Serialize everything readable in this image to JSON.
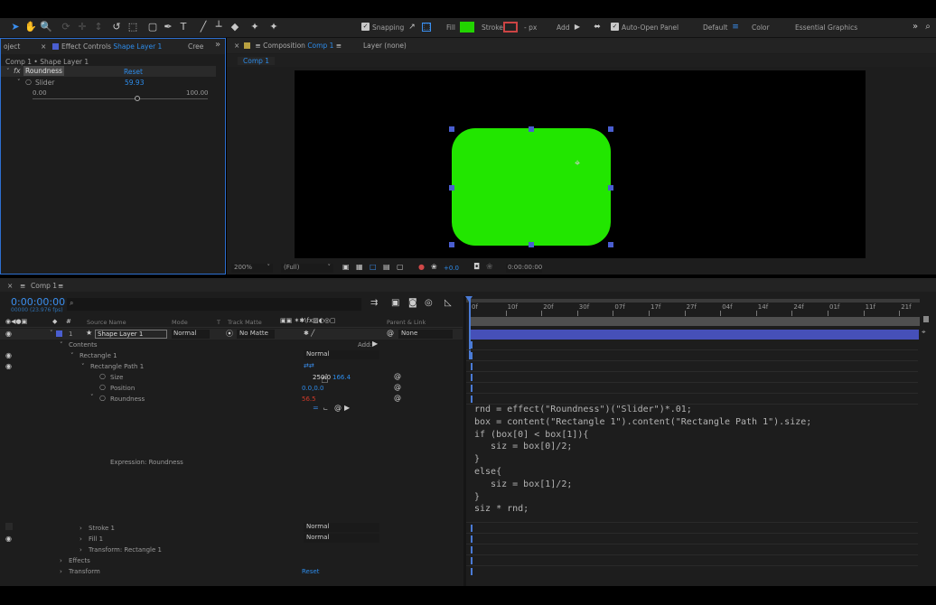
{
  "colors": {
    "accent": "#2d8ceb",
    "fill_swatch": "#22d400",
    "shape_fill": "#22e600",
    "layer_bar": "#4650b8",
    "red_value": "#d03a2a"
  },
  "toolbar": {
    "tool_icons": [
      "selection-tool-icon",
      "hand-tool-icon",
      "zoom-tool-icon",
      "orbit-tool-icon",
      "pan-tool-icon",
      "dolly-tool-icon",
      "rotate-tool-icon",
      "anchor-tool-icon",
      "rectangle-tool-icon",
      "pen-tool-icon",
      "type-tool-icon",
      "brush-tool-icon",
      "stamp-tool-icon",
      "eraser-tool-icon",
      "roto-tool-icon",
      "puppet-tool-icon"
    ],
    "snapping": "Snapping",
    "fill": "Fill",
    "stroke": "Stroke",
    "stroke_px": "- px",
    "add": "Add",
    "auto_open_panel": "Auto-Open Panel",
    "workspace_default": "Default",
    "workspace_color": "Color",
    "workspace_essential": "Essential Graphics"
  },
  "effect_panel": {
    "tab_project": "oject",
    "tab_effect_controls": "Effect Controls",
    "tab_effect_layer": "Shape Layer 1",
    "tab_create": "Cree",
    "breadcrumb": "Comp 1 • Shape Layer 1",
    "fx_label": "fx",
    "effect_name": "Roundness",
    "reset": "Reset",
    "slider_label": "Slider",
    "slider_value": "59.93",
    "slider_min": "0.00",
    "slider_max": "100.00",
    "slider_fraction": 0.5993
  },
  "comp_panel": {
    "tab_composition": "Composition",
    "tab_comp_name": "Comp 1",
    "tab_layer": "Layer (none)",
    "subtab": "Comp 1",
    "zoom": "200%",
    "resolution": "(Full)",
    "exposure": "+0.0",
    "timecode": "0:00:00:00"
  },
  "timeline": {
    "tab": "Comp 1",
    "timecode": "0:00:00:00",
    "fps": "00000 (23.976 fps)",
    "search_placeholder": "",
    "headers": {
      "source_name": "Source Name",
      "mode": "Mode",
      "t": "T",
      "track_matte": "Track Matte",
      "parent_link": "Parent & Link"
    },
    "layer": {
      "number": "1",
      "name": "Shape Layer 1",
      "mode": "Normal",
      "matte": "No Matte",
      "parent": "None"
    },
    "contents": "Contents",
    "add": "Add:",
    "rectangle_1": "Rectangle 1",
    "rect_mode": "Normal",
    "rectangle_path_1": "Rectangle Path 1",
    "size_label": "Size",
    "size_value_x": "250.0",
    "size_value_y": "166.4",
    "position_label": "Position",
    "position_value": "0.0,0.0",
    "roundness_label": "Roundness",
    "roundness_value": "56.5",
    "expression_label": "Expression: Roundness",
    "stroke_1": "Stroke 1",
    "stroke_mode": "Normal",
    "fill_1": "Fill 1",
    "fill_mode": "Normal",
    "transform_rect": "Transform: Rectangle 1",
    "effects": "Effects",
    "transform": "Transform",
    "transform_reset": "Reset",
    "ruler": [
      "0f",
      "10f",
      "20f",
      "30f",
      "07f",
      "17f",
      "27f",
      "04f",
      "14f",
      "24f",
      "01f",
      "11f",
      "21f"
    ]
  },
  "expression_code": "rnd = effect(\"Roundness\")(\"Slider\")*.01;\nbox = content(\"Rectangle 1\").content(\"Rectangle Path 1\").size;\nif (box[0] < box[1]){\n   siz = box[0]/2;\n}\nelse{\n   siz = box[1]/2;\n}\nsiz * rnd;"
}
